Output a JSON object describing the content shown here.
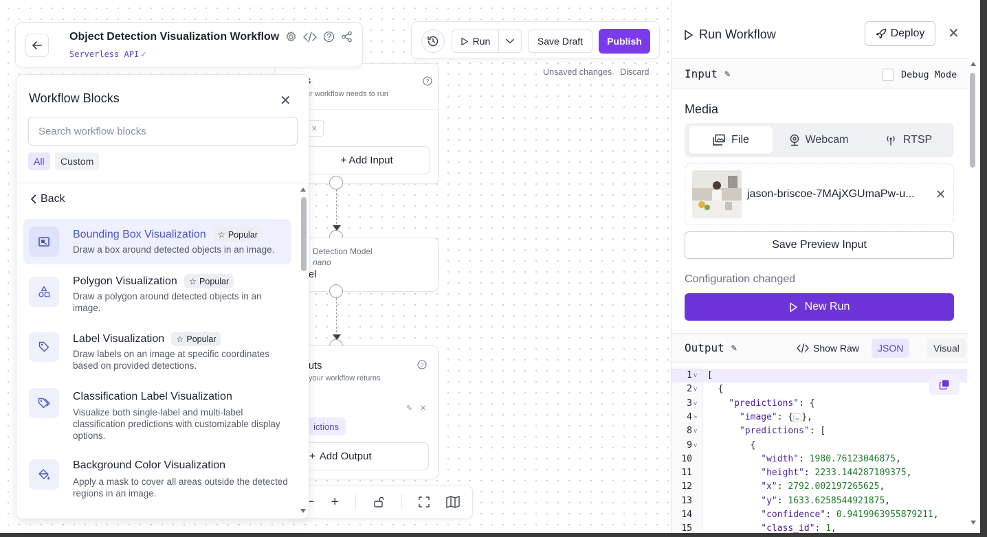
{
  "header": {
    "title": "Object Detection Visualization Workflow",
    "subtitle": "Serverless API",
    "check": "✓",
    "icons": [
      "back-arrow-icon",
      "settings-gear-icon",
      "code-icon",
      "help-circle-icon",
      "share-icon"
    ]
  },
  "toolbar": {
    "run_label": "Run",
    "save_draft_label": "Save Draft",
    "publish_label": "Publish",
    "unsaved_text": "Unsaved changes",
    "discard_label": "Discard"
  },
  "canvas": {
    "inputs_node": {
      "title_fragment": "s",
      "desc_fragment": "ur workflow needs to run",
      "add_label": "+ Add Input"
    },
    "model_node": {
      "line1": "Detection Model",
      "line2": "nano",
      "line3": "el"
    },
    "outputs_node": {
      "title_fragment": "uts",
      "desc_fragment": "your workflow returns",
      "chip": "ictions",
      "add_label": "Add Output"
    }
  },
  "blocks_panel": {
    "title": "Workflow Blocks",
    "search_placeholder": "Search workflow blocks",
    "filters": [
      "All",
      "Custom"
    ],
    "back_label": "Back",
    "popular_label": "Popular",
    "items": [
      {
        "name": "Bounding Box Visualization",
        "desc": "Draw a box around detected objects in an image.",
        "popular": true,
        "icon": "bounding-box-icon"
      },
      {
        "name": "Polygon Visualization",
        "desc": "Draw a polygon around detected objects in an image.",
        "popular": true,
        "icon": "shapes-icon"
      },
      {
        "name": "Label Visualization",
        "desc": "Draw labels on an image at specific coordinates based on provided detections.",
        "popular": true,
        "icon": "tag-icon"
      },
      {
        "name": "Classification Label Visualization",
        "desc": "Visualize both single-label and multi-label classification predictions with customizable display options.",
        "popular": false,
        "icon": "tags-icon"
      },
      {
        "name": "Background Color Visualization",
        "desc": "Apply a mask to cover all areas outside the detected regions in an image.",
        "popular": false,
        "icon": "paint-bucket-icon"
      }
    ]
  },
  "run_panel": {
    "title": "Run Workflow",
    "deploy_label": "Deploy",
    "input_label": "Input",
    "debug_label": "Debug Mode",
    "media_label": "Media",
    "media_tabs": [
      "File",
      "Webcam",
      "RTSP"
    ],
    "file_name": "jason-briscoe-7MAjXGUmaPw-u...",
    "save_preview_label": "Save Preview Input",
    "config_changed": "Configuration changed",
    "new_run_label": "New Run",
    "output_label": "Output",
    "show_raw_label": "Show Raw",
    "formats": [
      "JSON",
      "Visual"
    ]
  },
  "output_json_lines": [
    {
      "ln": "1",
      "fold": "v",
      "text": "["
    },
    {
      "ln": "2",
      "fold": "v",
      "text": "  {"
    },
    {
      "ln": "3",
      "fold": "v",
      "key": "    \"predictions\"",
      "rest": ": {"
    },
    {
      "ln": "4",
      "fold": ">",
      "key": "      \"image\"",
      "rest": ": {",
      "collapsed": "…",
      "rest2": "},"
    },
    {
      "ln": "8",
      "fold": "v",
      "key": "      \"predictions\"",
      "rest": ": ["
    },
    {
      "ln": "9",
      "fold": "v",
      "text": "        {"
    },
    {
      "ln": "10",
      "fold": "",
      "key": "          \"width\"",
      "rest": ": ",
      "num": "1980.76123046875",
      "tail": ","
    },
    {
      "ln": "11",
      "fold": "",
      "key": "          \"height\"",
      "rest": ": ",
      "num": "2233.144287109375",
      "tail": ","
    },
    {
      "ln": "12",
      "fold": "",
      "key": "          \"x\"",
      "rest": ": ",
      "num": "2792.002197265625",
      "tail": ","
    },
    {
      "ln": "13",
      "fold": "",
      "key": "          \"y\"",
      "rest": ": ",
      "num": "1633.6258544921875",
      "tail": ","
    },
    {
      "ln": "14",
      "fold": "",
      "key": "          \"confidence\"",
      "rest": ": ",
      "num": "0.9419963955879211",
      "tail": ","
    },
    {
      "ln": "15",
      "fold": "",
      "key": "          \"class_id\"",
      "rest": ": ",
      "num": "1",
      "tail": ","
    }
  ]
}
